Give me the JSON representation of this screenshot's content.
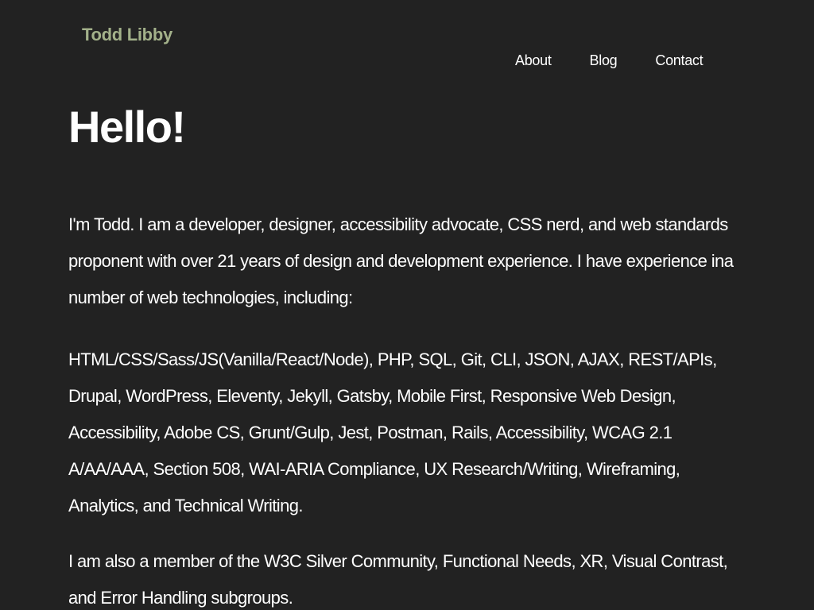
{
  "header": {
    "site_title": "Todd Libby",
    "nav": [
      {
        "label": "About"
      },
      {
        "label": "Blog"
      },
      {
        "label": "Contact"
      }
    ]
  },
  "main": {
    "heading": "Hello!",
    "paragraphs": [
      "I'm Todd. I am a developer, designer, accessibility advocate, CSS nerd, and web standards proponent with over 21 years of design and development experience. I have experience ina number of web technologies, including:",
      "HTML/CSS/Sass/JS(Vanilla/React/Node), PHP, SQL, Git, CLI, JSON, AJAX, REST/APIs, Drupal, WordPress, Eleventy, Jekyll, Gatsby, Mobile First, Responsive Web Design, Accessibility, Adobe CS, Grunt/Gulp, Jest, Postman, Rails, Accessibility, WCAG 2.1 A/AA/AAA, Section 508, WAI-ARIA Compliance, UX Research/Writing, Wireframing, Analytics, and Technical Writing.",
      "I am also a member of the W3C Silver Community, Functional Needs, XR, Visual Contrast, and Error Handling subgroups."
    ]
  },
  "colors": {
    "background": "#222222",
    "site_title": "#a3b18a",
    "text": "#ffffff"
  }
}
